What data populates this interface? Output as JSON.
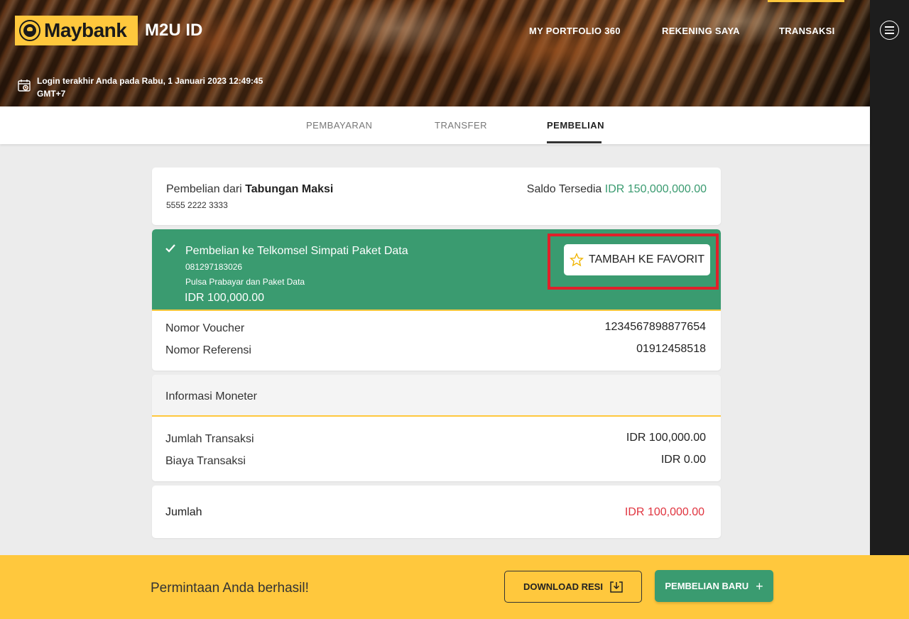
{
  "header": {
    "logo_text": "Maybank",
    "app_title": "M2U ID",
    "nav": [
      "MY PORTFOLIO 360",
      "REKENING SAYA",
      "TRANSAKSI"
    ],
    "last_login": "Login terakhir Anda pada Rabu, 1 Januari 2023 12:49:45 GMT+7"
  },
  "tabs": [
    "PEMBAYARAN",
    "TRANSFER",
    "PEMBELIAN"
  ],
  "source": {
    "label": "Pembelian dari",
    "account_name": "Tabungan Maksi",
    "account_number": "5555 2222 3333",
    "balance_label": "Saldo Tersedia",
    "balance_amount": "IDR 150,000,000.00"
  },
  "purchase": {
    "title": "Pembelian ke Telkomsel Simpati Paket Data",
    "phone": "081297183026",
    "category": "Pulsa Prabayar dan Paket Data",
    "amount": "IDR 100,000.00",
    "favorite_label": "TAMBAH KE FAVORIT",
    "voucher_label": "Nomor Voucher",
    "voucher_value": "1234567898877654",
    "reference_label": "Nomor Referensi",
    "reference_value": "01912458518"
  },
  "monetary": {
    "heading": "Informasi Moneter",
    "amount_label": "Jumlah Transaksi",
    "amount_value": "IDR 100,000.00",
    "fee_label": "Biaya Transaksi",
    "fee_value": "IDR 0.00"
  },
  "total": {
    "label": "Jumlah",
    "value": "IDR 100,000.00"
  },
  "footer": {
    "message": "Permintaan Anda berhasil!",
    "download_label": "DOWNLOAD RESI",
    "new_purchase_label": "PEMBELIAN BARU",
    "plus": "+"
  },
  "colors": {
    "brand_yellow": "#ffc83d",
    "success_green": "#3a9b70",
    "total_red": "#e0343f",
    "highlight_red": "#e0202a"
  },
  "icons": [
    "calendar-clock-icon",
    "hamburger-menu-icon",
    "check-icon",
    "star-icon",
    "download-icon",
    "plus-icon"
  ]
}
